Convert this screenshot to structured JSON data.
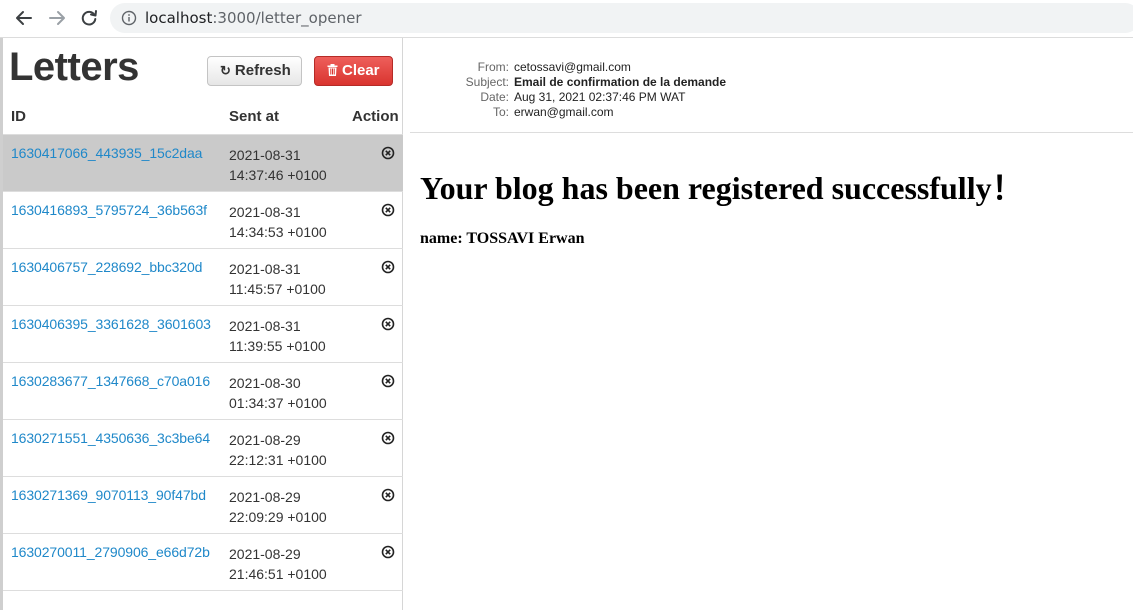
{
  "browser": {
    "url_host": "localhost",
    "url_path": ":3000/letter_opener",
    "icons": [
      "back-arrow-icon",
      "forward-arrow-icon",
      "reload-icon",
      "info-icon"
    ]
  },
  "sidebar": {
    "title": "Letters",
    "refresh_label": "Refresh",
    "clear_label": "Clear",
    "columns": {
      "id": "ID",
      "sent_at": "Sent at",
      "action": "Action"
    },
    "rows": [
      {
        "id": "1630417066_443935_15c2daa",
        "date": "2021-08-31",
        "time": "14:37:46 +0100",
        "selected": true
      },
      {
        "id": "1630416893_5795724_36b563f",
        "date": "2021-08-31",
        "time": "14:34:53 +0100",
        "selected": false
      },
      {
        "id": "1630406757_228692_bbc320d",
        "date": "2021-08-31",
        "time": "11:45:57 +0100",
        "selected": false
      },
      {
        "id": "1630406395_3361628_3601603",
        "date": "2021-08-31",
        "time": "11:39:55 +0100",
        "selected": false
      },
      {
        "id": "1630283677_1347668_c70a016",
        "date": "2021-08-30",
        "time": "01:34:37 +0100",
        "selected": false
      },
      {
        "id": "1630271551_4350636_3c3be64",
        "date": "2021-08-29",
        "time": "22:12:31 +0100",
        "selected": false
      },
      {
        "id": "1630271369_9070113_90f47bd",
        "date": "2021-08-29",
        "time": "22:09:29 +0100",
        "selected": false
      },
      {
        "id": "1630270011_2790906_e66d72b",
        "date": "2021-08-29",
        "time": "21:46:51 +0100",
        "selected": false
      }
    ],
    "colors": {
      "link": "#1f88c9",
      "selected_row": "#cacaca",
      "clear_button": "#d9342f"
    }
  },
  "email": {
    "from_label": "From:",
    "from": "cetossavi@gmail.com",
    "subject_label": "Subject:",
    "subject": "Email de confirmation de la demande",
    "date_label": "Date:",
    "date": "Aug 31, 2021 02:37:46 PM WAT",
    "to_label": "To:",
    "to": "erwan@gmail.com",
    "body_heading": "Your blog has been registered successfully！",
    "body_line": "name: TOSSAVI Erwan"
  }
}
